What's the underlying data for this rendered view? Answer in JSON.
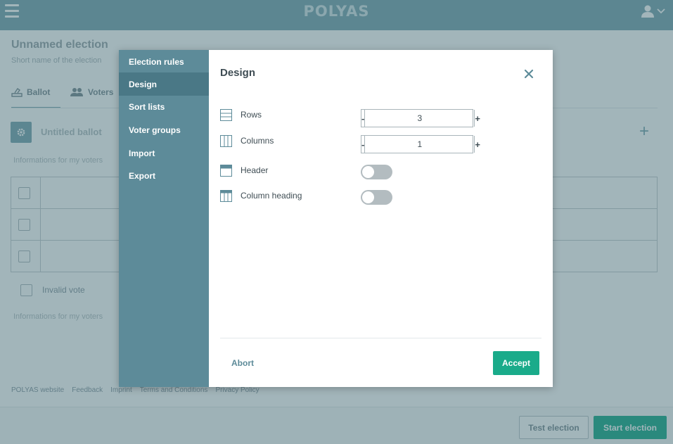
{
  "app": {
    "logo_text": "POLYAS"
  },
  "election": {
    "title": "Unnamed election",
    "short_name_placeholder": "Short name of the election"
  },
  "tabs": [
    {
      "label": "Ballot",
      "icon": "ballot-box-icon"
    },
    {
      "label": "Voters",
      "icon": "users-icon"
    }
  ],
  "ballot": {
    "title_placeholder": "Untitled ballot",
    "info_top_placeholder": "Informations for my voters",
    "info_bottom_placeholder": "Informations for my voters",
    "invalid_vote_label": "Invalid vote",
    "row_count": 3
  },
  "footer": {
    "links": [
      "POLYAS website",
      "Feedback",
      "Imprint",
      "Terms and Conditions",
      "Privacy Policy"
    ]
  },
  "actions": {
    "test_label": "Test election",
    "start_label": "Start election"
  },
  "modal": {
    "title": "Design",
    "nav": [
      {
        "label": "Election rules",
        "active": false
      },
      {
        "label": "Design",
        "active": true
      },
      {
        "label": "Sort lists",
        "active": false
      },
      {
        "label": "Voter groups",
        "active": false
      },
      {
        "label": "Import",
        "active": false
      },
      {
        "label": "Export",
        "active": false
      }
    ],
    "options": {
      "rows": {
        "label": "Rows",
        "value": "3",
        "minus": "-",
        "plus": "+",
        "icon": "rows-icon"
      },
      "columns": {
        "label": "Columns",
        "value": "1",
        "minus": "-",
        "plus": "+",
        "icon": "columns-icon"
      },
      "header": {
        "label": "Header",
        "enabled": false,
        "icon": "header-icon"
      },
      "column_heading": {
        "label": "Column heading",
        "enabled": false,
        "icon": "column-heading-icon"
      }
    },
    "abort_label": "Abort",
    "accept_label": "Accept"
  },
  "colors": {
    "brand": "#7aa5b1",
    "nav_bg": "#5d8b99",
    "accent_green": "#1aab8a"
  }
}
